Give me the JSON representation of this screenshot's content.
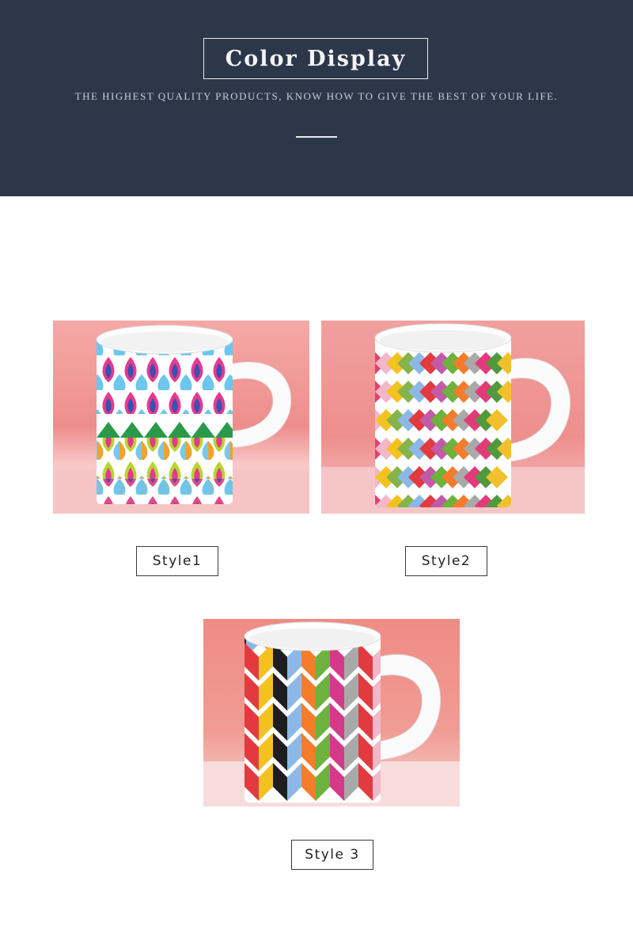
{
  "header": {
    "title": "Color Display",
    "subtitle": "THE HIGHEST QUALITY PRODUCTS, KNOW HOW TO GIVE THE BEST OF YOUR LIFE."
  },
  "products": [
    {
      "label": "Style1"
    },
    {
      "label": "Style2"
    },
    {
      "label": "Style 3"
    }
  ],
  "colors": {
    "header_bg": "#2d374a",
    "backdrop_pink": "#f29a98",
    "mug_white": "#fbfbfb"
  }
}
